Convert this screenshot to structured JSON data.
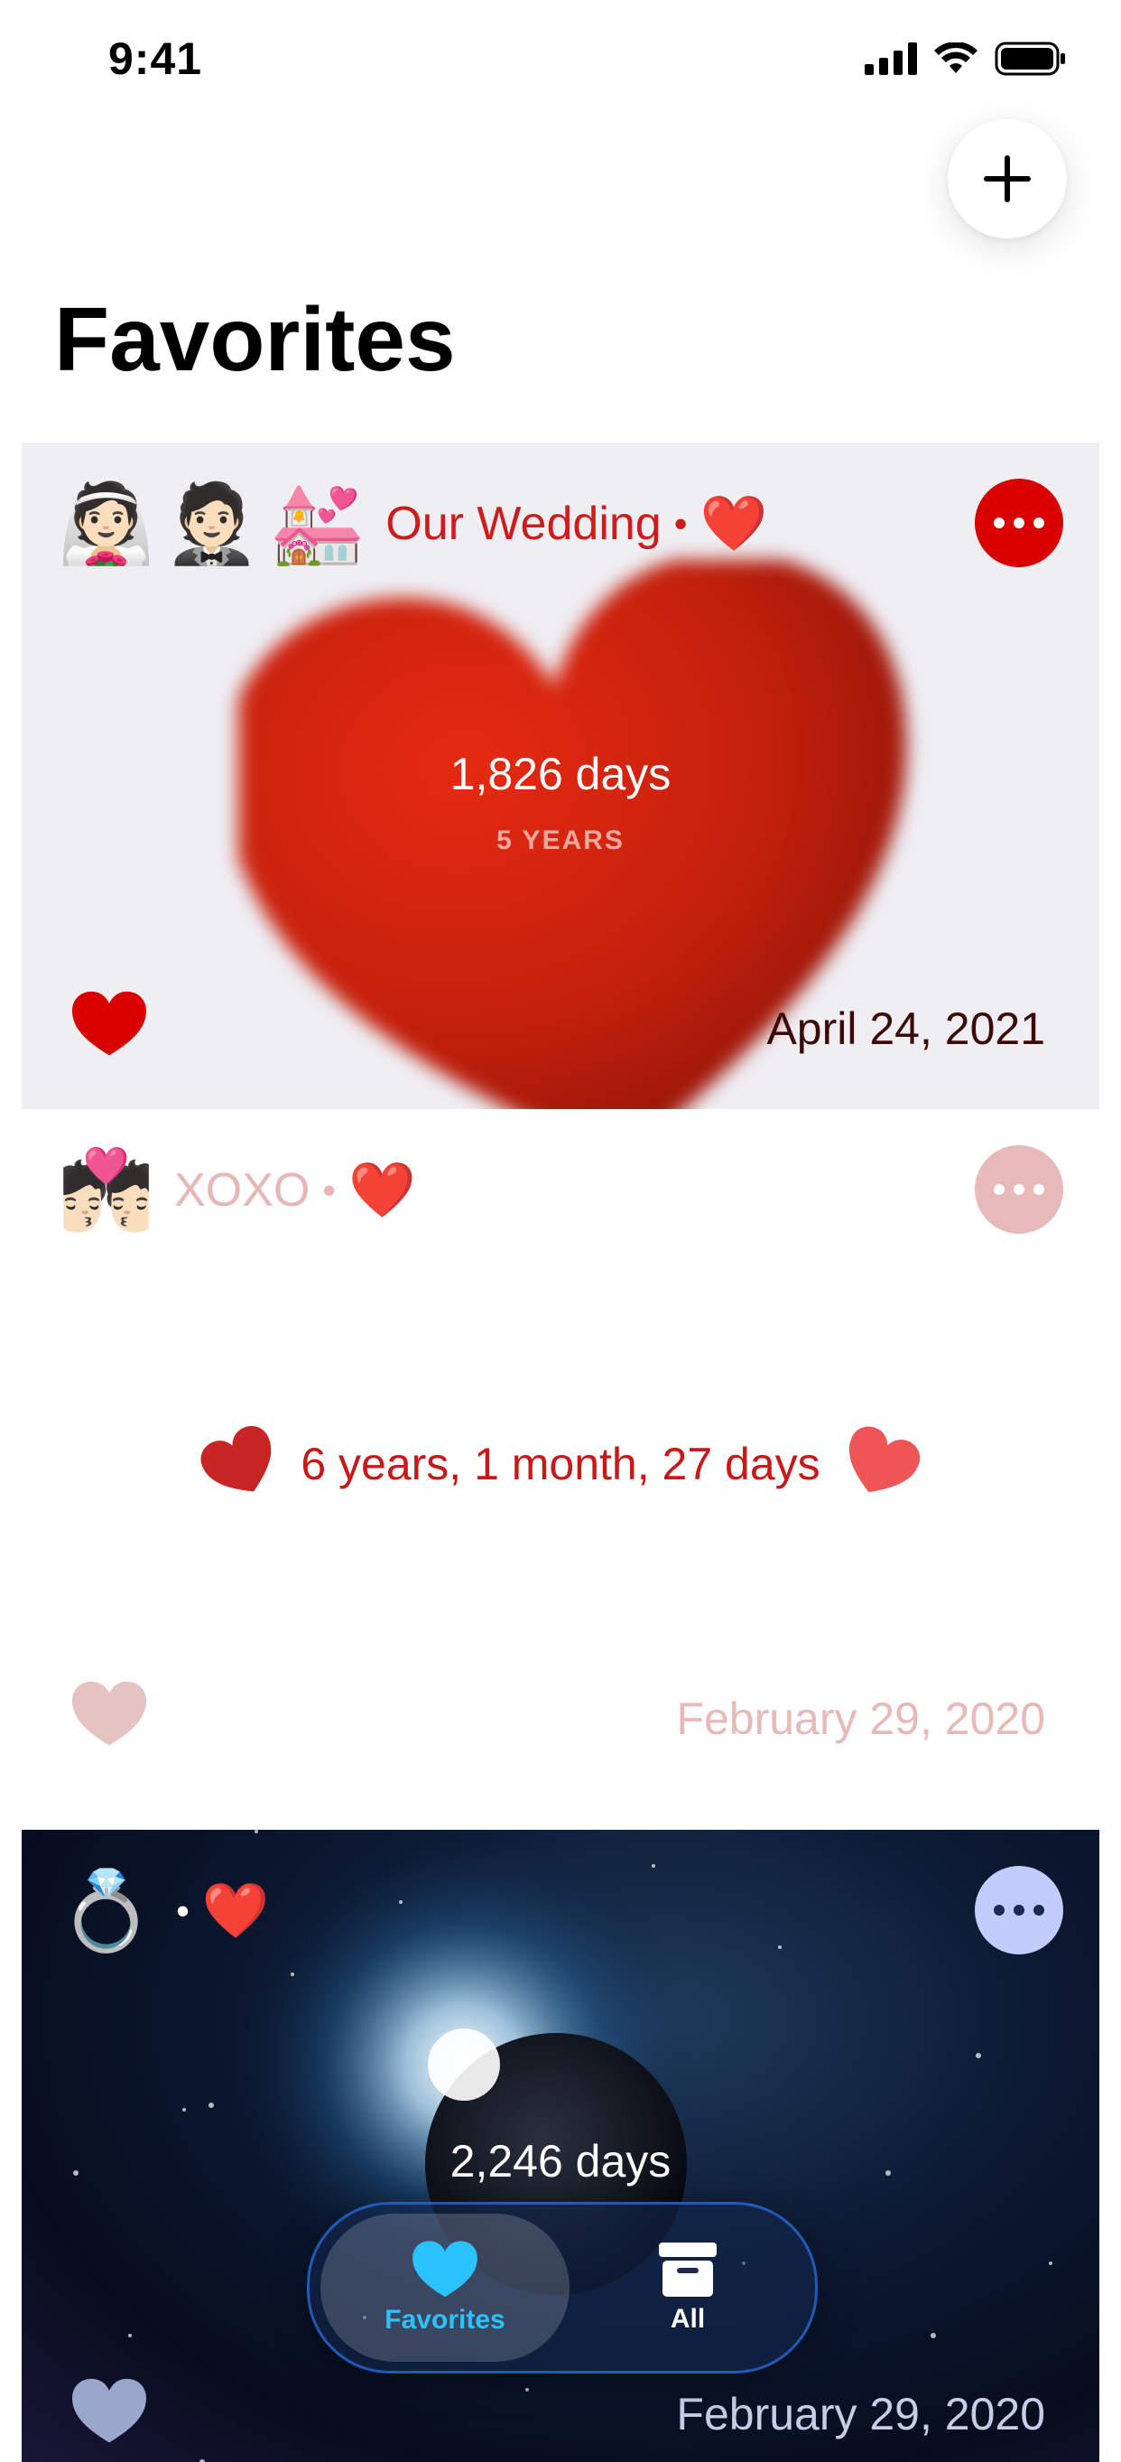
{
  "status_bar": {
    "time": "9:41"
  },
  "header": {
    "title": "Favorites"
  },
  "cards": [
    {
      "emojis": [
        "👰🏻",
        "🤵🏻",
        "💒"
      ],
      "label": "Our Wedding",
      "separator": "•",
      "marker": "❤️",
      "days": "1,826 days",
      "years": "5 YEARS",
      "date": "April 24, 2021"
    },
    {
      "emojis": [
        "💏🏻"
      ],
      "label": "XOXO",
      "separator": "•",
      "marker": "❤️",
      "duration": "6 years, 1 month, 27 days",
      "date": "February 29, 2020"
    },
    {
      "emojis": [
        "💍"
      ],
      "separator": "•",
      "marker": "❤️",
      "days": "2,246 days",
      "date": "February 29, 2020"
    }
  ],
  "tab_bar": {
    "tabs": [
      {
        "label": "Favorites",
        "icon": "heart-icon",
        "active": true
      },
      {
        "label": "All",
        "icon": "archive-box-icon",
        "active": false
      }
    ]
  },
  "colors": {
    "accent_red": "#d20000",
    "wedding_label": "#cc1c1c",
    "xoxo_label": "#e8b6b6",
    "tab_active": "#2bc3ff"
  }
}
